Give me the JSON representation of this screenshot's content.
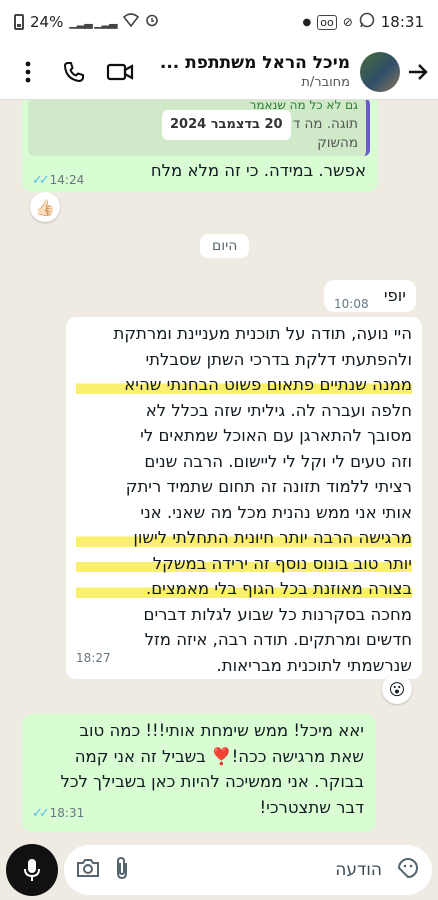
{
  "status_bar": {
    "battery": "24%",
    "time": "18:31"
  },
  "header": {
    "contact_name": "מיכל הראל משתתפת ...",
    "subtitle": "מחובר/ת"
  },
  "messages": {
    "quoted": {
      "line1": "גם לא כל מה שנאמר",
      "line2": "תוגה. מה ד           רים, במשקל",
      "line3": "מהשוק",
      "date_chip": "20 בדצמבר 2024"
    },
    "msg1": {
      "text": "אפשר. במידה. כי זה מלא מלח",
      "time": "14:24",
      "reaction": "👍🏻"
    },
    "day_separator": "היום",
    "msg2": {
      "text": "יופי",
      "time": "10:08"
    },
    "msg3": {
      "lines": [
        "היי נועה, תודה על תוכנית מעניינת ומרתקת",
        "ולהפתעתי דלקת בדרכי השתן שסבלתי",
        "ממנה שנתיים פתאום פשוט הבחנתי שהיא",
        "חלפה ועברה לה. גיליתי שזה בכלל לא",
        "מסובך להתארגן עם האוכל שמתאים לי",
        "וזה טעים לי וקל לי ליישום. הרבה שנים",
        "רציתי ללמוד  תזונה זה תחום שתמיד ריתק",
        "אותי  אני ממש נהנית מכל מה שאני.   אני",
        "מרגישה הרבה יותר חיונית התחלתי לישון",
        "יותר טוב בונוס נוסף זה ירידה במשקל",
        "בצורה מאוזנת בכל הגוף בלי מאמצים.",
        "מחכה בסקרנות כל שבוע לגלות דברים",
        "חדשים ומרתקים. תודה רבה, איזה מזל",
        "שנרשמתי לתוכנית מבריאות."
      ],
      "time": "18:27",
      "reaction": "😮"
    },
    "msg4": {
      "lines": [
        "יאא מיכל! ממש שימחת אותי!!! כמה טוב",
        "שאת מרגישה ככה!❣️ בשביל זה אני קמה",
        "בבוקר. אני ממשיכה להיות כאן בשבילך לכל",
        "דבר שתצטרכי!"
      ],
      "time": "18:31"
    }
  },
  "composer": {
    "placeholder": "הודעה"
  },
  "colors": {
    "outgoing": "#d9fdd3",
    "incoming": "#ffffff",
    "background": "#efeae2",
    "ticks": "#53bdeb",
    "highlight": "#faeb3c"
  }
}
